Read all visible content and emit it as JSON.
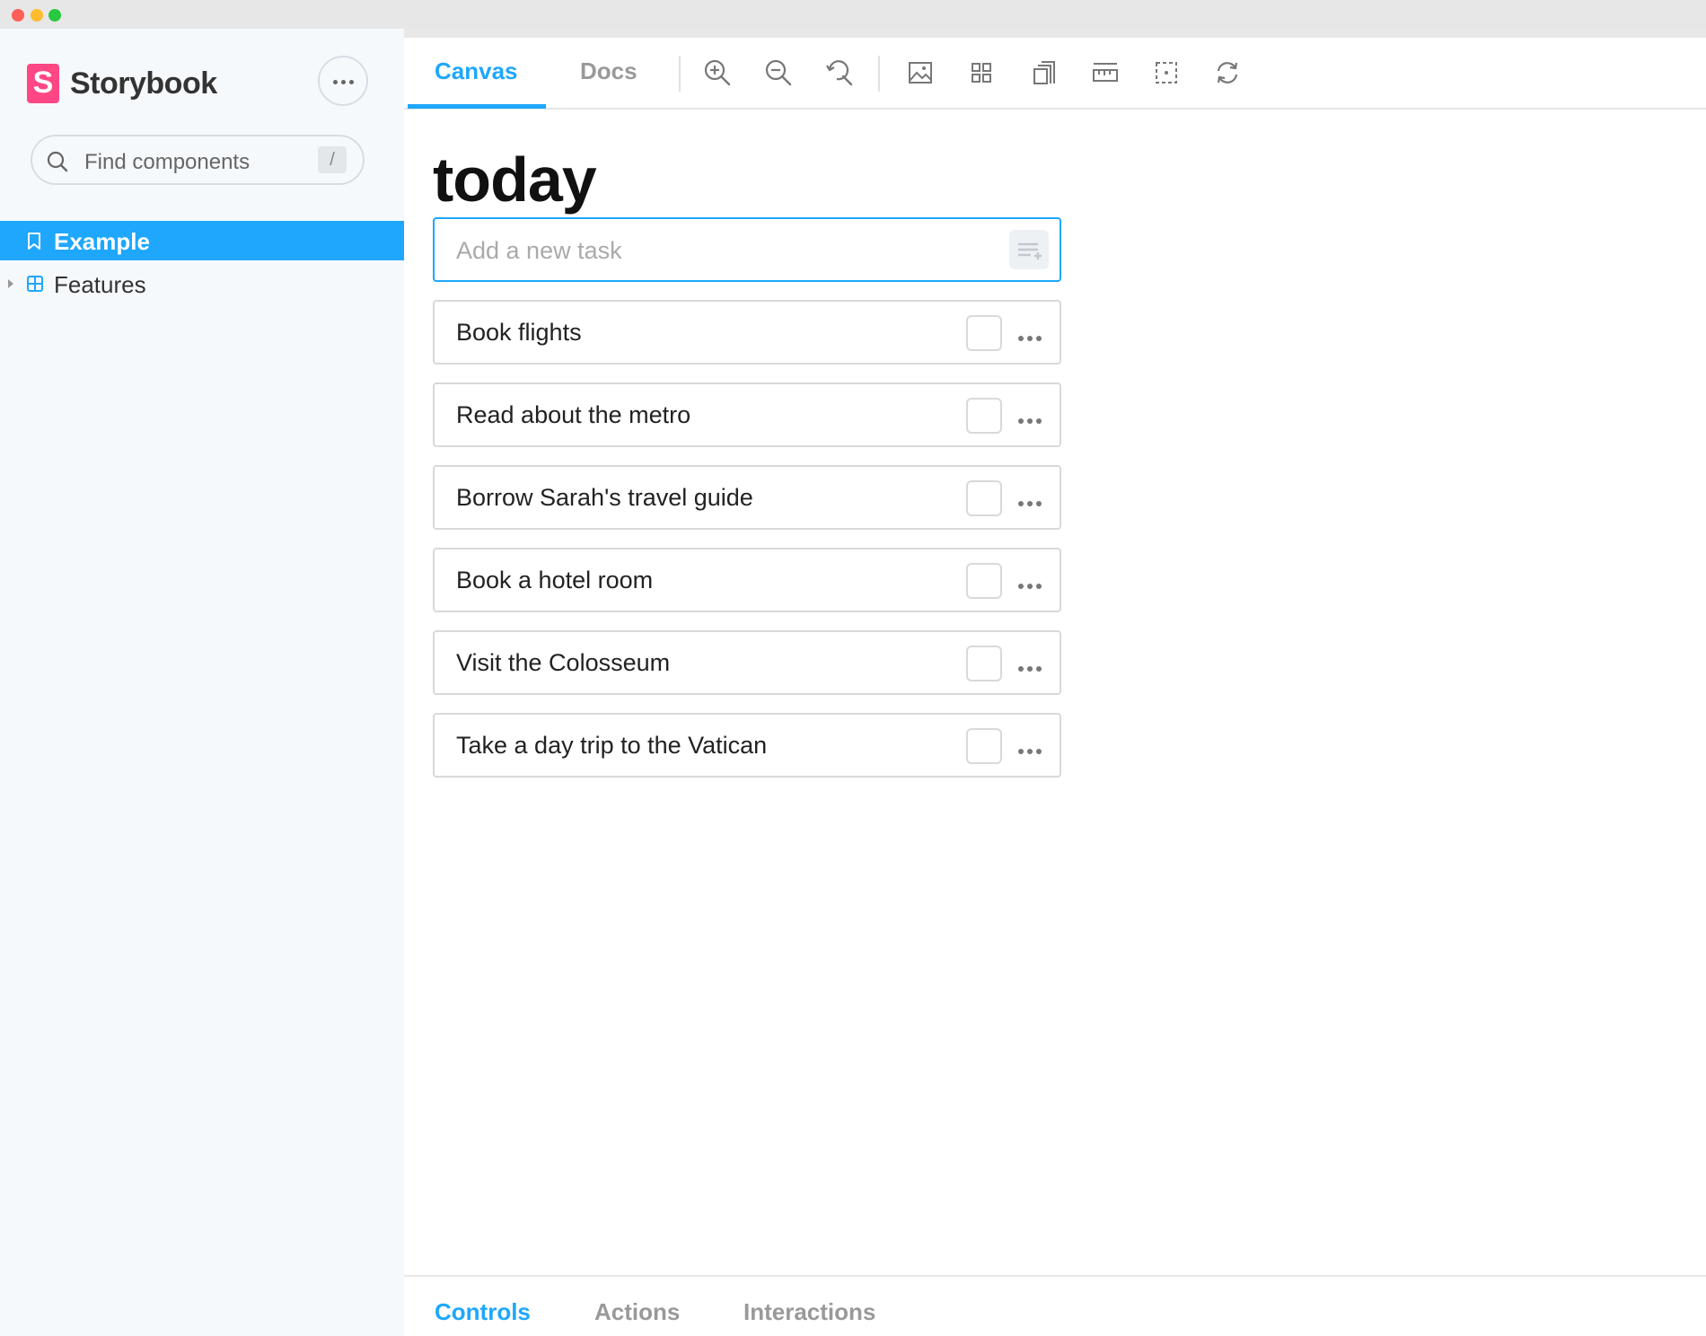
{
  "window": {
    "controls": [
      "close",
      "minimize",
      "zoom"
    ]
  },
  "sidebar": {
    "brand": {
      "mark": "S",
      "name": "Storybook",
      "color": "#ff4785"
    },
    "menu_icon": "ellipsis-icon",
    "search": {
      "placeholder": "Find components",
      "shortcut": "/"
    },
    "items": [
      {
        "label": "Example",
        "icon": "bookmark-icon",
        "active": true
      },
      {
        "label": "Features",
        "icon": "component-icon",
        "active": false,
        "collapsed": true
      }
    ]
  },
  "toolbar": {
    "tabs": [
      {
        "label": "Canvas",
        "active": true
      },
      {
        "label": "Docs",
        "active": false
      }
    ],
    "tools": [
      "zoom-in-icon",
      "zoom-out-icon",
      "zoom-reset-icon",
      "background-icon",
      "grid-icon",
      "viewport-icon",
      "measure-icon",
      "outline-icon",
      "remount-icon"
    ]
  },
  "canvas": {
    "title": "today",
    "new_task_placeholder": "Add a new task",
    "tasks": [
      {
        "title": "Book flights",
        "done": false
      },
      {
        "title": "Read about the metro",
        "done": false
      },
      {
        "title": "Borrow Sarah's travel guide",
        "done": false
      },
      {
        "title": "Book a hotel room",
        "done": false
      },
      {
        "title": "Visit the Colosseum",
        "done": false
      },
      {
        "title": "Take a day trip to the Vatican",
        "done": false
      }
    ]
  },
  "addons": {
    "tabs": [
      {
        "label": "Controls",
        "active": true
      },
      {
        "label": "Actions",
        "active": false
      },
      {
        "label": "Interactions",
        "active": false
      }
    ]
  },
  "colors": {
    "accent": "#1ea7fd",
    "brand": "#ff4785",
    "sidebar_bg": "#f6f9fc"
  }
}
